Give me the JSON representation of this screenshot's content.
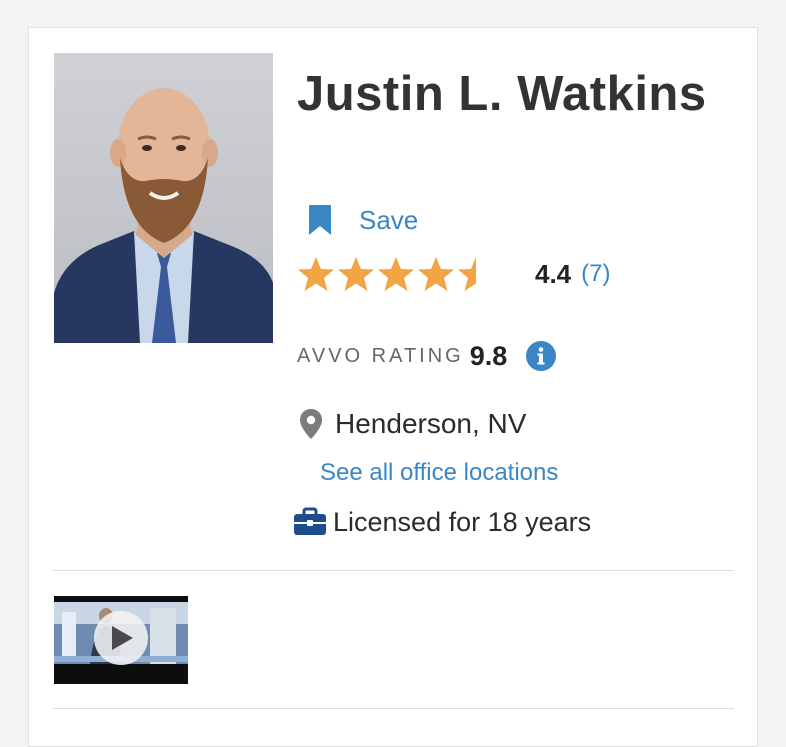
{
  "profile": {
    "name": "Justin L. Watkins",
    "photo_alt": "Justin L. Watkins"
  },
  "save": {
    "label": "Save",
    "icon": "bookmark-icon"
  },
  "rating": {
    "stars": 4.4,
    "max_stars": 5,
    "value": "4.4",
    "review_count": "(7)",
    "star_color": "#f2a444"
  },
  "avvo": {
    "label": "AVVO RATING",
    "score": "9.8",
    "info_icon": "info-icon"
  },
  "location": {
    "text": "Henderson, NV",
    "icon": "map-pin-icon",
    "all_offices_link": "See all office locations"
  },
  "license": {
    "text": "Licensed for 18 years",
    "icon": "briefcase-icon"
  },
  "video": {
    "icon": "play-icon"
  },
  "colors": {
    "link": "#3b86c4",
    "accent_dark": "#1f4d8c",
    "text": "#2b2b2b"
  }
}
